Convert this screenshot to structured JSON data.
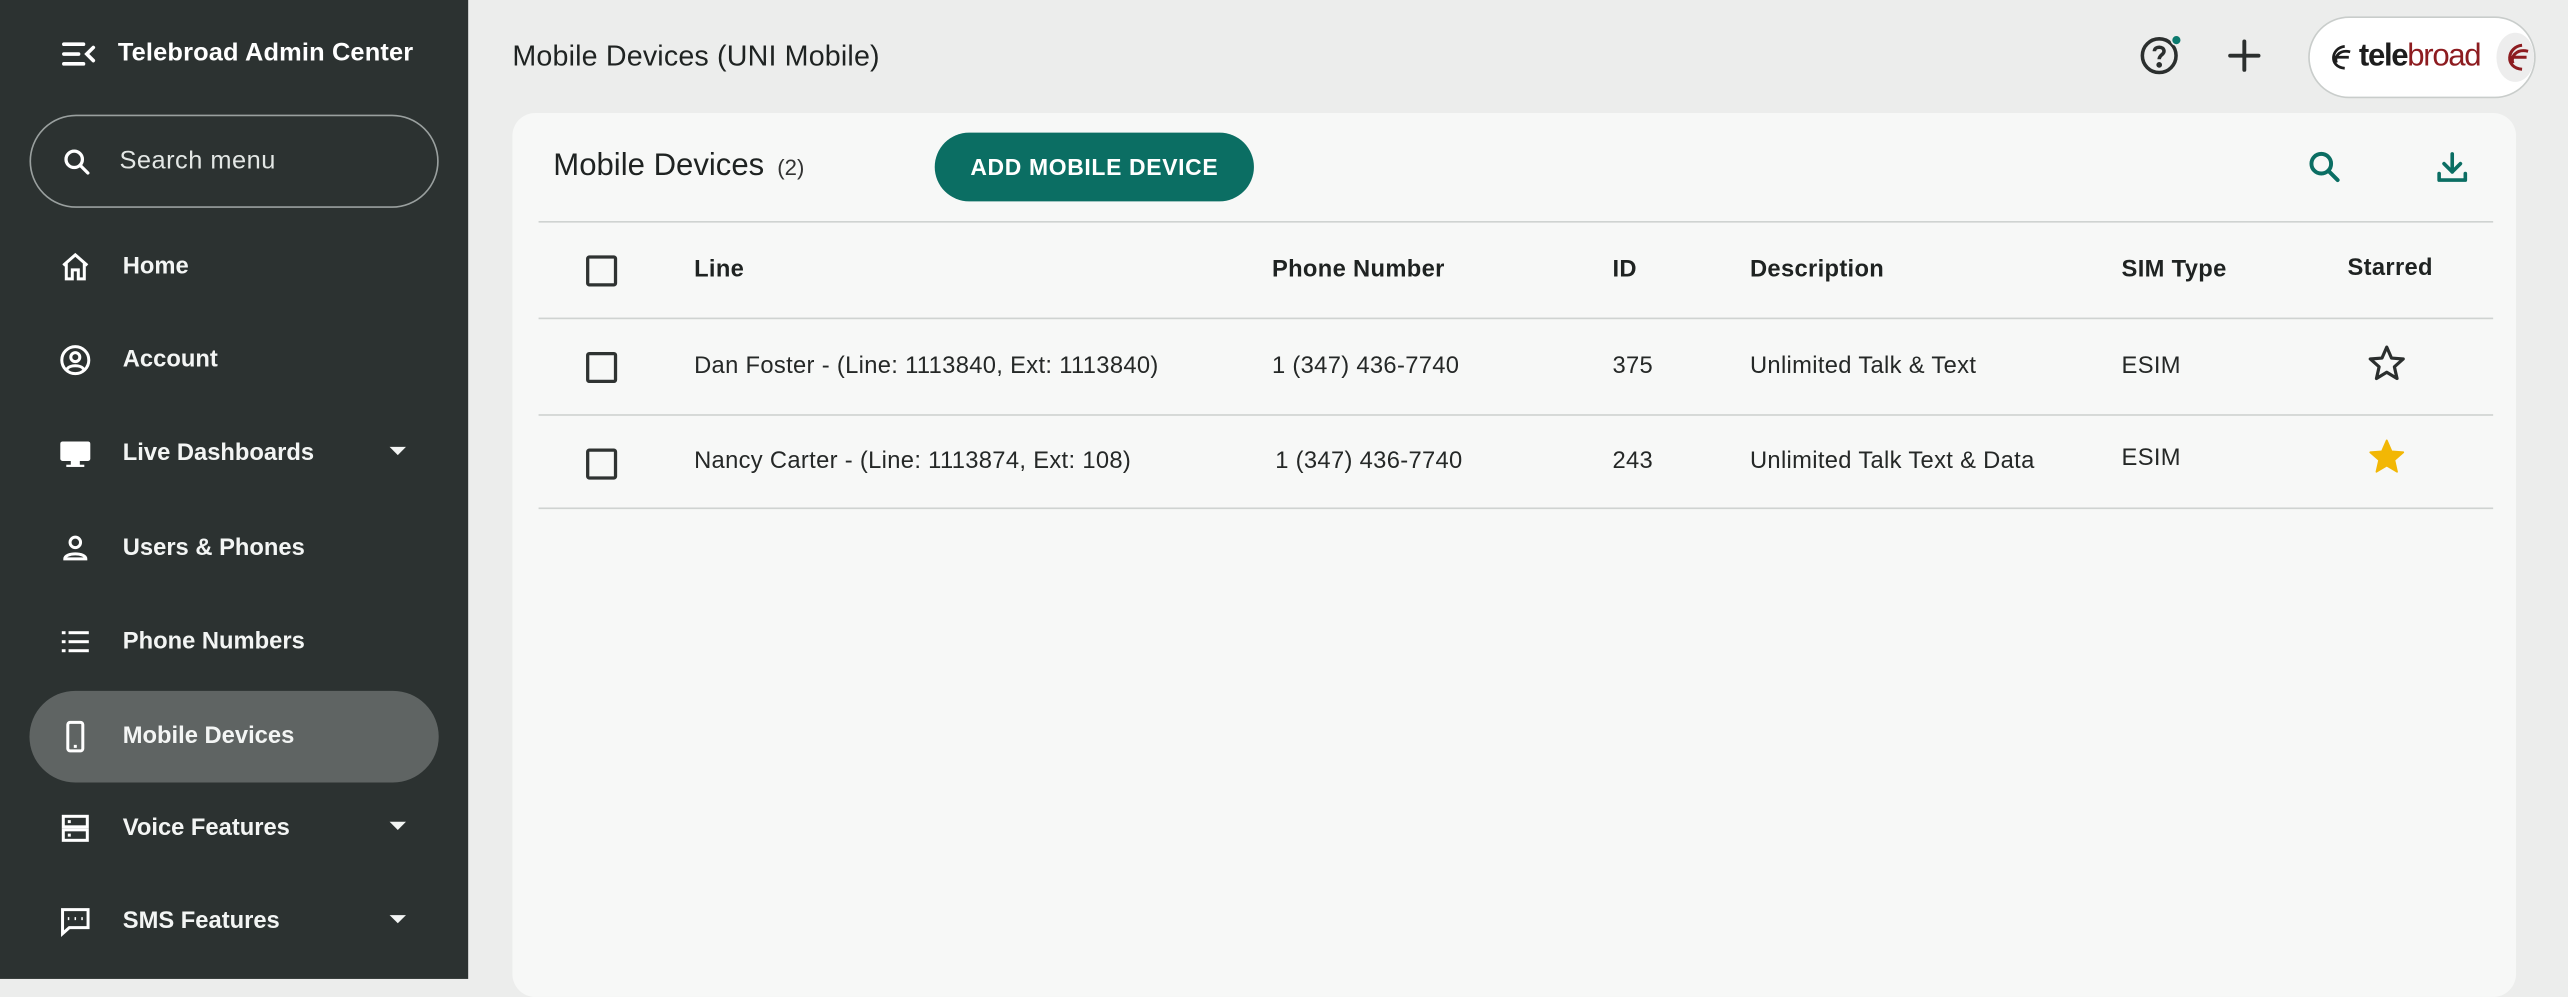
{
  "app": {
    "title": "Telebroad Admin Center",
    "menu_toggle_icon": "menu-collapse-icon"
  },
  "sidebar": {
    "search_placeholder": "Search menu",
    "search_icon": "search-icon",
    "items": [
      {
        "label": "Home",
        "icon": "home-icon",
        "expandable": false,
        "active": false
      },
      {
        "label": "Account",
        "icon": "account-circle-icon",
        "expandable": false,
        "active": false
      },
      {
        "label": "Live Dashboards",
        "icon": "monitor-icon",
        "expandable": true,
        "active": false
      },
      {
        "label": "Users & Phones",
        "icon": "person-icon",
        "expandable": false,
        "active": false
      },
      {
        "label": "Phone Numbers",
        "icon": "list-icon",
        "expandable": false,
        "active": false
      },
      {
        "label": "Mobile Devices",
        "icon": "smartphone-icon",
        "expandable": false,
        "active": true
      },
      {
        "label": "Voice Features",
        "icon": "storage-icon",
        "expandable": true,
        "active": false
      },
      {
        "label": "SMS Features",
        "icon": "chat-icon",
        "expandable": true,
        "active": false
      }
    ]
  },
  "header": {
    "page_title": "Mobile Devices (UNI Mobile)",
    "help_icon": "help-icon",
    "add_icon": "plus-icon",
    "brand": {
      "part1": "tele",
      "part2": "broad"
    }
  },
  "card": {
    "title": "Mobile Devices",
    "count": "(2)",
    "add_button_label": "ADD MOBILE DEVICE",
    "search_icon": "search-icon",
    "download_icon": "download-icon"
  },
  "table": {
    "columns": [
      "Line",
      "Phone Number",
      "ID",
      "Description",
      "SIM Type",
      "Starred"
    ],
    "rows": [
      {
        "line": "Dan Foster - (Line: 1113840, Ext: 1113840)",
        "phone": "1 (347) 436-7740",
        "id": "375",
        "description": "Unlimited Talk & Text",
        "sim": "ESIM",
        "starred": false
      },
      {
        "line": "Nancy Carter - (Line: 1113874, Ext: 108)",
        "phone": "1 (347) 436-7740",
        "id": "243",
        "description": "Unlimited Talk Text & Data",
        "sim": "ESIM",
        "starred": true
      }
    ]
  },
  "colors": {
    "sidebar_bg": "#2c3231",
    "accent": "#0b6e63",
    "star_filled": "#f2b705"
  }
}
